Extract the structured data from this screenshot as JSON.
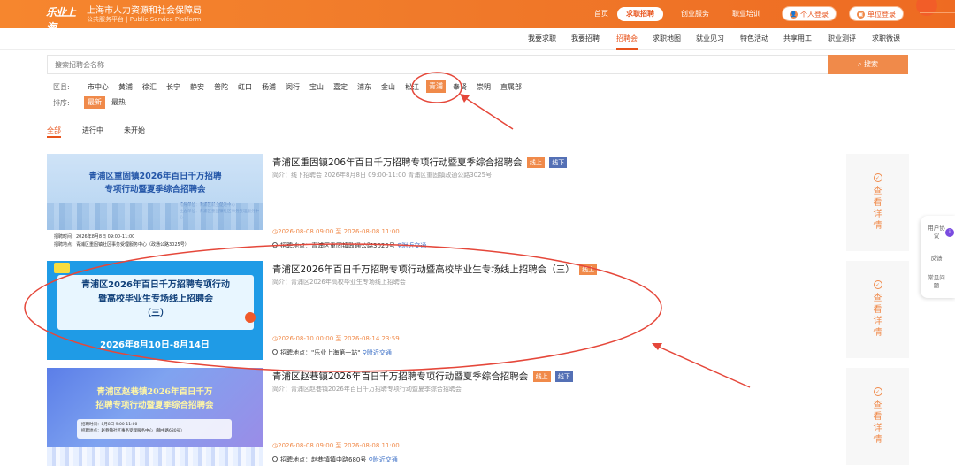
{
  "header": {
    "logo_text": "乐业上海",
    "title": "上海市人力资源和社会保障局",
    "subtitle": "公共服务平台 | Public Service Platform",
    "nav": [
      "首页",
      "求职招聘",
      "创业服务",
      "职业培训"
    ],
    "personal_login": "个人登录",
    "org_login": "单位登录"
  },
  "subnav": [
    "我要求职",
    "我要招聘",
    "招聘会",
    "求职地图",
    "就业见习",
    "特色活动",
    "共享用工",
    "职业测评",
    "求职微课"
  ],
  "search": {
    "placeholder": "搜索招聘会名称",
    "button": "搜索"
  },
  "filters": {
    "district_label": "区县:",
    "districts": [
      "市中心",
      "黄浦",
      "徐汇",
      "长宁",
      "静安",
      "普陀",
      "虹口",
      "杨浦",
      "闵行",
      "宝山",
      "嘉定",
      "浦东",
      "金山",
      "松江",
      "青浦",
      "奉贤",
      "崇明",
      "直属部"
    ],
    "active_district": "青浦",
    "sort_label": "排序:",
    "sort_options": [
      "最新",
      "最热"
    ]
  },
  "status_tabs": [
    "全部",
    "进行中",
    "未开始"
  ],
  "cards": [
    {
      "title": "青浦区重固镇206年百日千万招聘专项行动暨夏季综合招聘会",
      "tags": [
        "线上",
        "线下"
      ],
      "intro": "简介：线下招聘会 2026年8月8日 09:00-11:00 青浦区重固镇政通公路3025号",
      "time": "2026-08-08 09:00 至 2026-08-08 11:00",
      "addr_label": "招聘地点：",
      "addr": "青浦区重固镇政通公路3025号",
      "nearby": "附近交通",
      "detail": "查看详情",
      "banner": {
        "title_line1": "青浦区重固镇2026年百日千万招聘",
        "title_line2": "专项行动暨夏季综合招聘会",
        "info_line1": "招聘时间：2026年8月8日 09:00-11:00",
        "info_line2": "招聘地点：青浦区重固镇社区事务受理服务中心（政通公路3025号）",
        "org1": "指导单位：青浦区就业促进中心",
        "org2": "主办单位：青浦区重固镇社区事务受理服务中心"
      }
    },
    {
      "title": "青浦区2026年百日千万招聘专项行动暨高校毕业生专场线上招聘会（三）",
      "tags": [
        "线上"
      ],
      "intro": "简介：青浦区2026年高校毕业生专场线上招聘会",
      "time": "2026-08-10 00:00 至 2026-08-14 23:59",
      "addr_label": "招聘地点：",
      "addr": "\"乐业上海第一站\"",
      "nearby": "附近交通",
      "detail": "查看详情",
      "banner": {
        "title_line1": "青浦区2026年百日千万招聘专项行动",
        "title_line2": "暨高校毕业生专场线上招聘会",
        "title_line3": "（三）",
        "date": "2026年8月10日-8月14日"
      }
    },
    {
      "title": "青浦区赵巷镇2026年百日千万招聘专项行动暨夏季综合招聘会",
      "tags": [
        "线上",
        "线下"
      ],
      "intro": "简介：青浦区赵巷镇2026年百日千万招聘专项行动暨夏季综合招聘会",
      "time": "2026-08-08 09:00 至 2026-08-08 11:00",
      "addr_label": "招聘地点：",
      "addr": "赵巷镇镇中路680号",
      "nearby": "附近交通",
      "detail": "查看详情",
      "banner": {
        "title_line1": "青浦区赵巷镇2026年百日千万",
        "title_line2": "招聘专项行动暨夏季综合招聘会",
        "info_line1": "招聘时间：8月8日 9:00-11:00",
        "info_line2": "招聘地点：赵巷镇社区事务受理服务中心（镇中路680号）"
      }
    }
  ],
  "float_panel": {
    "items": [
      "用户协议",
      "反馈",
      "常见问题"
    ],
    "badge": "i"
  },
  "colors": {
    "brand": "#f08a4a",
    "active_nav": "#e8531b",
    "offline_tag": "#5470b5",
    "annotation": "#e5473a"
  }
}
